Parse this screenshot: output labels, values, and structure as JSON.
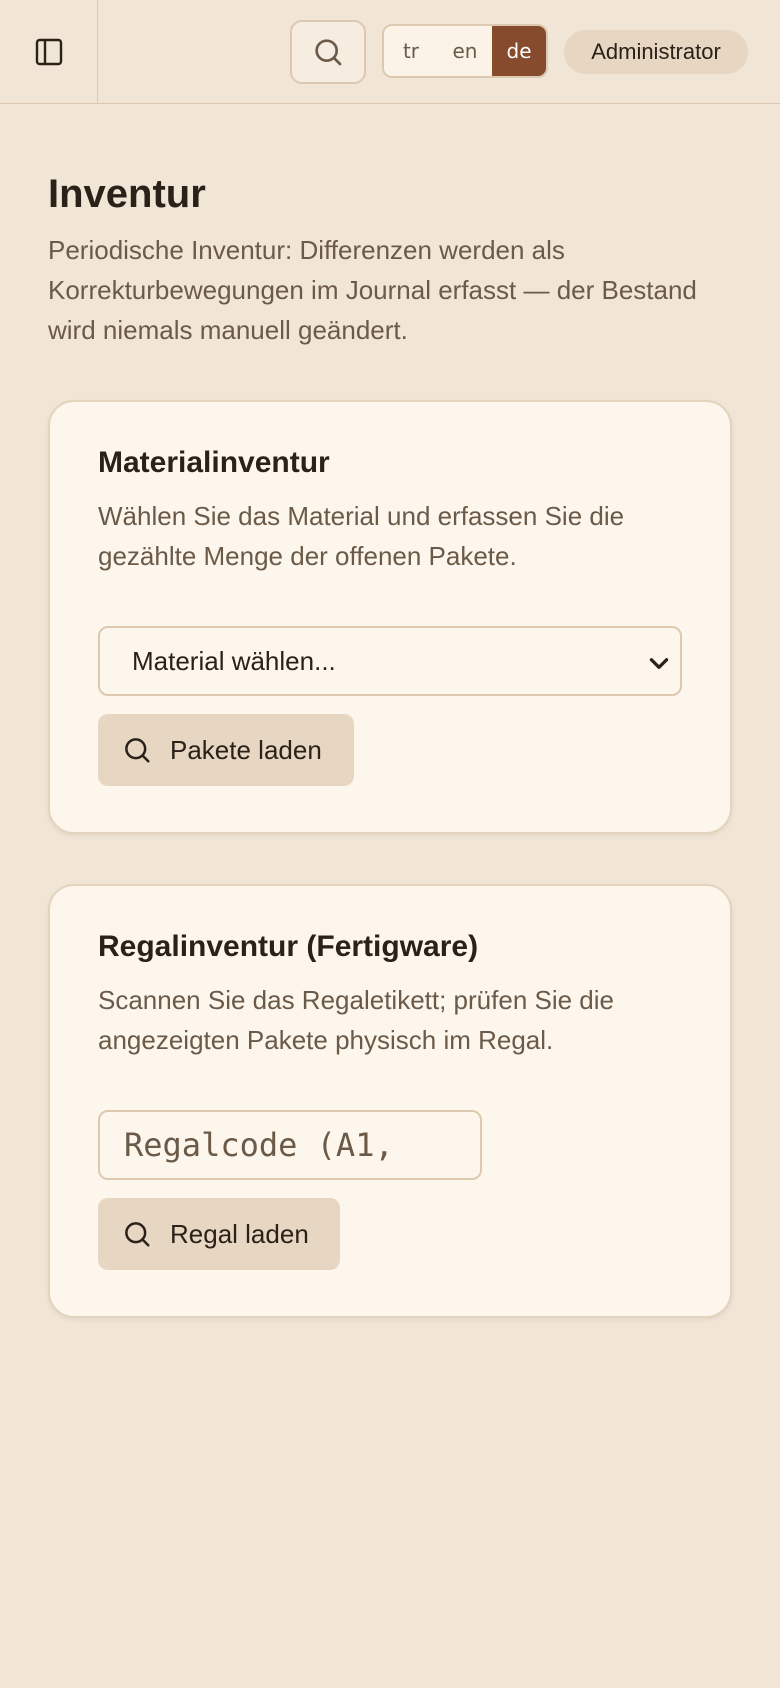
{
  "header": {
    "languages": [
      {
        "code": "tr",
        "active": false
      },
      {
        "code": "en",
        "active": false
      },
      {
        "code": "de",
        "active": true
      }
    ],
    "user_label": "Administrator",
    "icons": {
      "sidebar": "sidebar-toggle-icon",
      "search": "search-icon"
    }
  },
  "page": {
    "title": "Inventur",
    "description": "Periodische Inventur: Differenzen werden als Korrekturbewegungen im Journal erfasst — der Bestand wird niemals manuell geändert."
  },
  "material_card": {
    "title": "Materialinventur",
    "description": "Wählen Sie das Material und erfassen Sie die gezählte Menge der offenen Pakete.",
    "select_value": "Material wählen...",
    "button_label": "Pakete laden"
  },
  "shelf_card": {
    "title": "Regalinventur (Fertigware)",
    "description": "Scannen Sie das Regaletikett; prüfen Sie die angezeigten Pakete physisch im Regal.",
    "input_placeholder": "Regalcode (A1,",
    "button_label": "Regal laden"
  },
  "colors": {
    "background": "#f1e5d6",
    "card": "#fdf6ec",
    "accent": "#864a2c",
    "button": "#e6d6c2"
  }
}
